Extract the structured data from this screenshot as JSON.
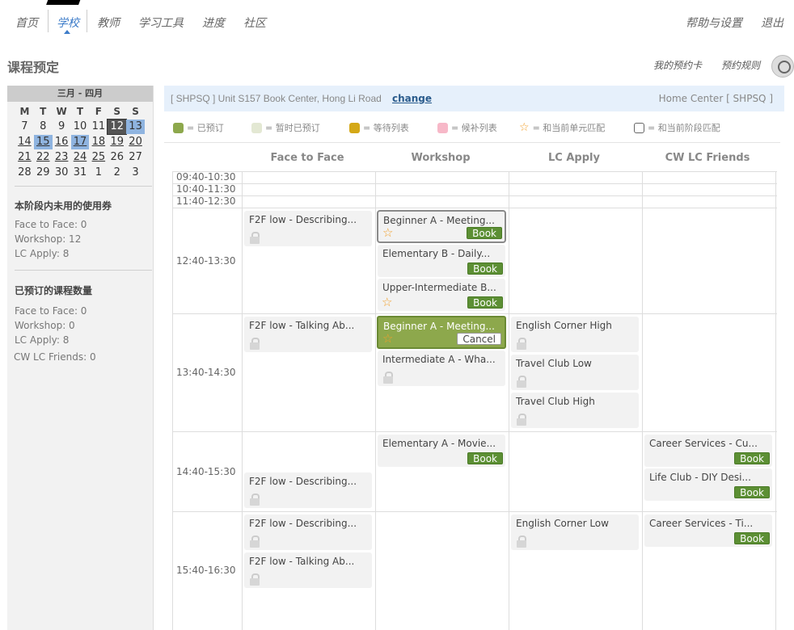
{
  "nav": {
    "items": [
      "首页",
      "学校",
      "教师",
      "学习工具",
      "进度",
      "社区"
    ],
    "right": [
      "帮助与设置",
      "退出"
    ]
  },
  "page": {
    "title": "课程预定",
    "links": [
      "我的预约卡",
      "预约规则"
    ]
  },
  "calendar": {
    "month_label": "三月 - 四月",
    "weekdays": [
      "M",
      "T",
      "W",
      "T",
      "F",
      "S",
      "S"
    ],
    "rows": [
      [
        "7",
        "8",
        "9",
        "10",
        "11",
        "12",
        "13"
      ],
      [
        "14",
        "15",
        "16",
        "17",
        "18",
        "19",
        "20"
      ],
      [
        "21",
        "22",
        "23",
        "24",
        "25",
        "26",
        "27"
      ],
      [
        "28",
        "29",
        "30",
        "31",
        "1",
        "2",
        "3"
      ]
    ]
  },
  "unused": {
    "title": "本阶段内未用的使用券",
    "lines": [
      "Face to Face: 0",
      "Workshop: 12",
      "LC Apply: 8"
    ]
  },
  "booked": {
    "title": "已预订的课程数量",
    "lines": [
      "Face to Face: 0",
      "Workshop: 0",
      "LC Apply: 8",
      "CW LC Friends: 0"
    ]
  },
  "center": {
    "left_text": "[ SHPSQ ]  Unit S157 Book Center, Hong Li Road",
    "change": "change",
    "right_text": "Home Center [ SHPSQ ]"
  },
  "legend": [
    {
      "label": "= 已预订",
      "color": "#8da84c"
    },
    {
      "label": "= 暂时已预订",
      "color": "#e3e8d3"
    },
    {
      "label": "= 等待列表",
      "color": "#d4a817"
    },
    {
      "label": "= 候补列表",
      "color": "#f7b8c8"
    },
    {
      "label": "= 和当前单元匹配",
      "icon": "star"
    },
    {
      "label": "= 和当前阶段匹配",
      "icon": "checkbox"
    }
  ],
  "columns": [
    "Face to Face",
    "Workshop",
    "LC Apply",
    "CW LC Friends"
  ],
  "times": [
    "09:40-10:30",
    "10:40-11:30",
    "11:40-12:30",
    "12:40-13:30",
    "13:40-14:30",
    "14:40-15:30",
    "15:40-16:30"
  ],
  "buttons": {
    "book": "Book",
    "cancel": "Cancel"
  },
  "cards": [
    "F2F low - Describing...",
    "Beginner A - Meeting...",
    "Elementary B - Daily...",
    "Upper-Intermediate B...",
    "F2F low - Talking Ab...",
    "Beginner A - Meeting...",
    "Intermediate A - Wha...",
    "English Corner High",
    "Travel Club Low",
    "Travel Club High",
    "Elementary A - Movie...",
    "Career Services - Cu...",
    "Life Club - DIY Desi...",
    "F2F low - Describing...",
    "F2F low - Describing...",
    "F2F low - Talking Ab...",
    "English Corner Low",
    "Career Services - Ti..."
  ]
}
